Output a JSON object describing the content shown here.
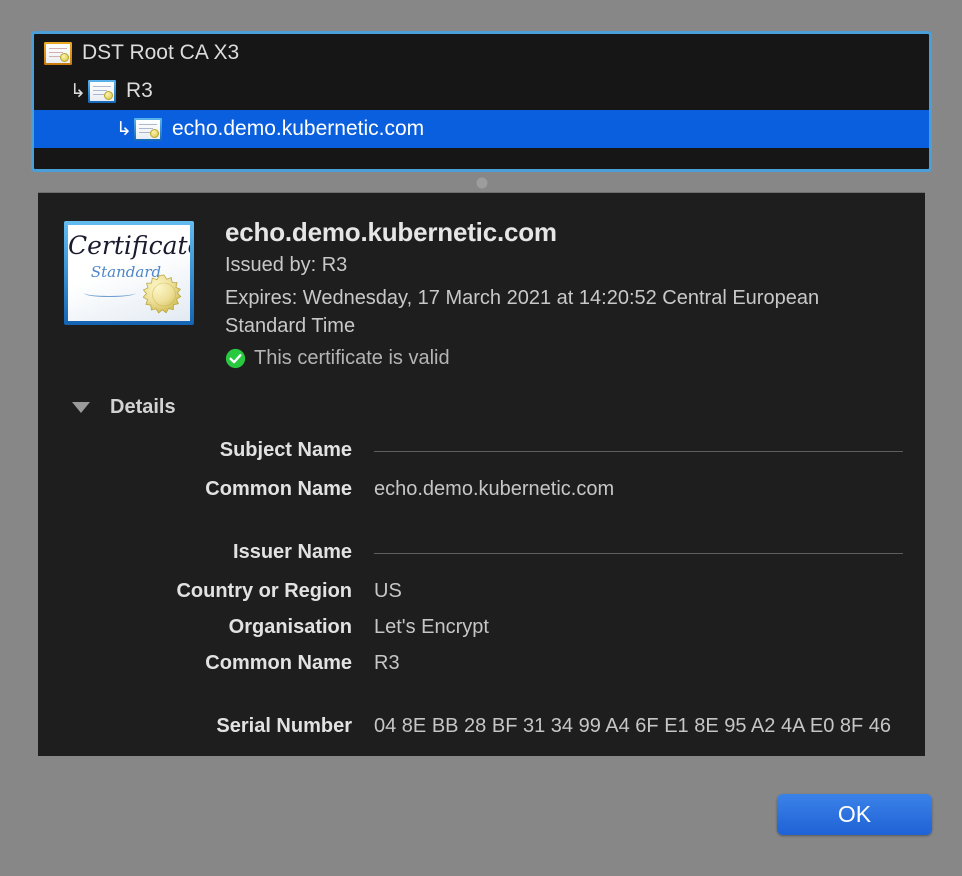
{
  "chain": {
    "rows": [
      {
        "label": "DST Root CA X3",
        "depth": 0,
        "icon": "certificate-root-icon",
        "icon_style": "gold",
        "selected": false,
        "arrow": ""
      },
      {
        "label": "R3",
        "depth": 1,
        "icon": "certificate-intermediate-icon",
        "icon_style": "blue",
        "selected": false,
        "arrow": "↳"
      },
      {
        "label": "echo.demo.kubernetic.com",
        "depth": 2,
        "icon": "certificate-leaf-icon",
        "icon_style": "blue",
        "selected": true,
        "arrow": "↳"
      }
    ]
  },
  "splitter": {
    "grabber": "splitter-grabber"
  },
  "certificate": {
    "image_title": "Certificate",
    "image_subtitle": "Standard",
    "title": "echo.demo.kubernetic.com",
    "issued_by": "Issued by: R3",
    "expires": "Expires: Wednesday, 17 March 2021 at 14:20:52 Central European Standard Time",
    "validity_text": "This certificate is valid",
    "validity_icon": "green-check-circle-icon"
  },
  "details": {
    "header_label": "Details",
    "disclosure_icon": "triangle-down-icon",
    "expanded": true,
    "fields": [
      {
        "label": "Subject Name",
        "value": "",
        "type": "section"
      },
      {
        "label": "Common Name",
        "value": "echo.demo.kubernetic.com",
        "type": "field"
      },
      {
        "label": "Issuer Name",
        "value": "",
        "type": "section",
        "gap_before": true
      },
      {
        "label": "Country or Region",
        "value": "US",
        "type": "field"
      },
      {
        "label": "Organisation",
        "value": "Let's Encrypt",
        "type": "field"
      },
      {
        "label": "Common Name",
        "value": "R3",
        "type": "field"
      },
      {
        "label": "Serial Number",
        "value": "04 8E BB 28 BF 31 34 99 A4 6F E1 8E 95 A2 4A E0 8F 46",
        "type": "field",
        "gap_before": true
      }
    ]
  },
  "footer": {
    "ok_label": "OK"
  },
  "colors": {
    "dialog_background": "#878787",
    "panel_background": "#1e1e1e",
    "tree_background": "#161616",
    "focus_ring": "#4a9fd8",
    "selection_blue": "#0a5fde",
    "accent_button": "#2f72e0",
    "valid_green": "#28c93f"
  }
}
